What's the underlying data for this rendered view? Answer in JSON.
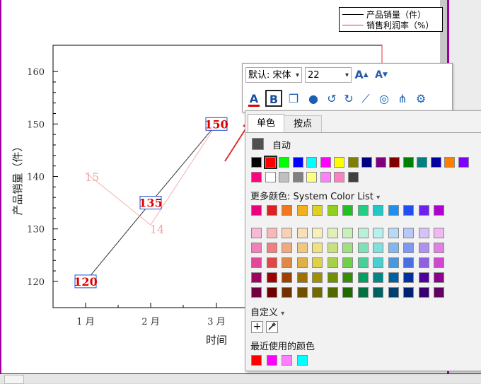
{
  "legend": {
    "items": [
      {
        "label": "产品销量（件）",
        "color": "#000000"
      },
      {
        "label": "销售利润率（%）",
        "color": "#e03030"
      }
    ]
  },
  "chart_data": {
    "type": "line",
    "categories": [
      "1 月",
      "2 月",
      "3 月"
    ],
    "xlabel": "时间",
    "ylabel": "产品销量（件）",
    "ylim": [
      115,
      165
    ],
    "yticks": [
      120,
      130,
      140,
      150,
      160
    ],
    "grid": false,
    "series": [
      {
        "name": "产品销量（件）",
        "values": [
          120,
          135,
          150
        ],
        "color": "#000000",
        "labels": [
          "120",
          "135",
          "150"
        ]
      },
      {
        "name": "销售利润率（%）",
        "values": [
          15,
          14,
          null
        ],
        "color": "#e03030",
        "labels": [
          "15",
          "14",
          ""
        ]
      }
    ]
  },
  "toolbar": {
    "font_value": "默认: 宋体",
    "size_value": "22",
    "grow_label": "A",
    "shrink_label": "A",
    "font_color_label": "A",
    "bold_label": "B"
  },
  "color_panel": {
    "tab_solid": "单色",
    "tab_by_point": "按点",
    "auto_label": "自动",
    "more_colors_label": "更多颜色: System Color List",
    "custom_label": "自定义",
    "recent_label": "最近使用的颜色",
    "plus_label": "+",
    "base_row1": [
      "#000000",
      "#ff0000",
      "#00ff00",
      "#0000ff",
      "#00ffff",
      "#ff00ff",
      "#ffff00",
      "#808000",
      "#000080",
      "#800080",
      "#800000",
      "#008000",
      "#008080",
      "#0000a0",
      "#ff8000",
      "#8000ff"
    ],
    "base_row2": [
      "#ff0080",
      "#ffffff",
      "#c0c0c0",
      "#808080",
      "#ffff80",
      "#ff80ff",
      "#ff80c0",
      "#404040"
    ],
    "vivid_row": [
      "#e8007c",
      "#e02020",
      "#f07820",
      "#f0b020",
      "#e0d020",
      "#90d020",
      "#20c020",
      "#20d080",
      "#20c8c8",
      "#2090f0",
      "#2050f0",
      "#7020f0",
      "#b000d0"
    ],
    "tint_rows": [
      [
        "#f8b8d8",
        "#f8b8b8",
        "#f8d0b8",
        "#f8e0b8",
        "#f8f0b8",
        "#e0f0b8",
        "#c8f0b8",
        "#b8f0d8",
        "#b8f0f0",
        "#b8d8f8",
        "#b8c8f8",
        "#d8c0f8",
        "#f0b8f0"
      ],
      [
        "#f080b8",
        "#f08080",
        "#f0a880",
        "#f0c880",
        "#f0e080",
        "#c8e080",
        "#a0e080",
        "#80e0b8",
        "#80e0e0",
        "#80b8f0",
        "#8098f0",
        "#b090f0",
        "#e080e0"
      ],
      [
        "#e04898",
        "#e04848",
        "#e08848",
        "#e0b048",
        "#e0d048",
        "#a8d048",
        "#70d048",
        "#48d098",
        "#48d0d0",
        "#4898e0",
        "#4870e0",
        "#9060e0",
        "#d048d0"
      ],
      [
        "#a00060",
        "#a00000",
        "#a04000",
        "#a07000",
        "#a09000",
        "#709000",
        "#309000",
        "#00a060",
        "#008888",
        "#0060a0",
        "#0030a0",
        "#5000a0",
        "#900090"
      ],
      [
        "#700040",
        "#700000",
        "#703000",
        "#705000",
        "#706800",
        "#506800",
        "#206800",
        "#007040",
        "#006060",
        "#004070",
        "#002070",
        "#380070",
        "#600060"
      ]
    ],
    "recent": [
      "#ff0000",
      "#ff00ff",
      "#ff80ff",
      "#00ffff"
    ]
  }
}
